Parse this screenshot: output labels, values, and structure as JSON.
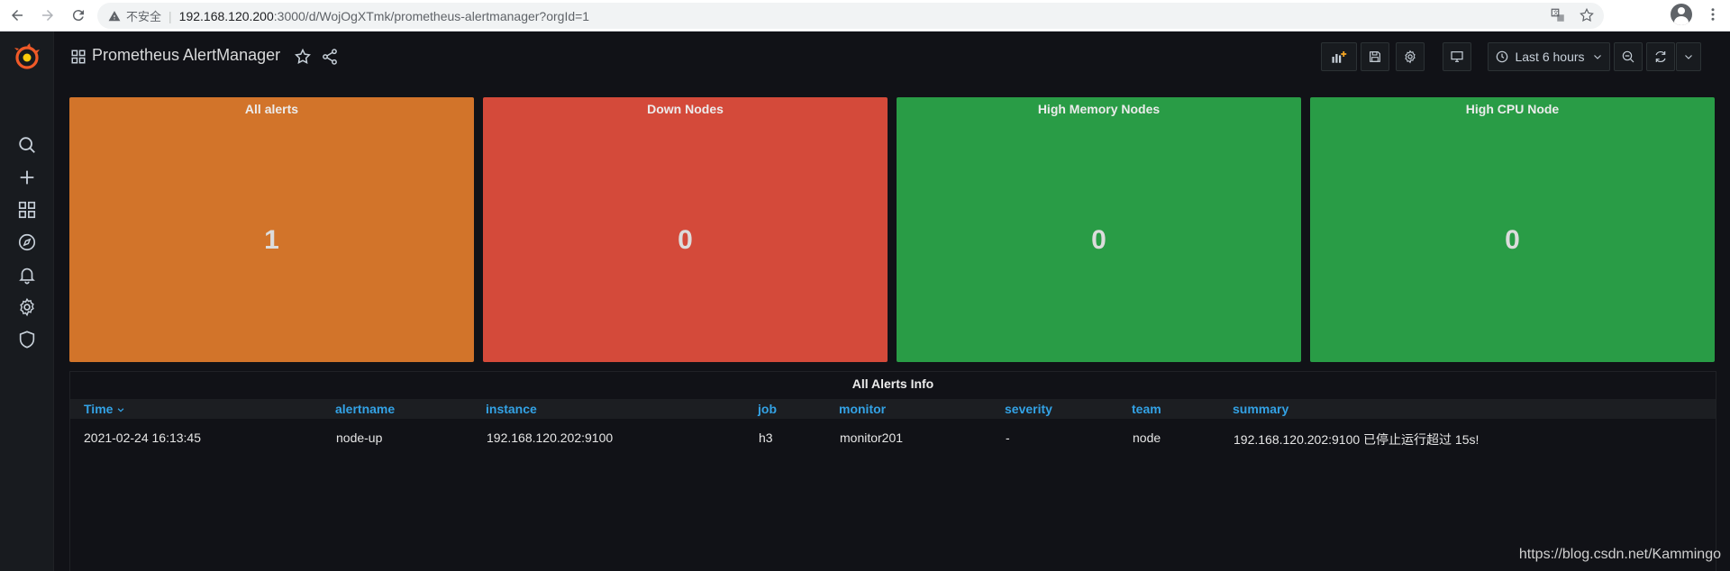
{
  "browser": {
    "insecure_label": "不安全",
    "url_host": "192.168.120.200",
    "url_rest": ":3000/d/WojOgXTmk/prometheus-alertmanager?orgId=1"
  },
  "dashboard": {
    "title": "Prometheus AlertManager",
    "time_range": "Last 6 hours"
  },
  "stat_panels": [
    {
      "title": "All alerts",
      "value": "1",
      "color": "#d2742a"
    },
    {
      "title": "Down Nodes",
      "value": "0",
      "color": "#d44a3a"
    },
    {
      "title": "High Memory Nodes",
      "value": "0",
      "color": "#299c46"
    },
    {
      "title": "High CPU Node",
      "value": "0",
      "color": "#299c46"
    }
  ],
  "alerts_table": {
    "title": "All Alerts Info",
    "columns": [
      "Time",
      "alertname",
      "instance",
      "job",
      "monitor",
      "severity",
      "team",
      "summary"
    ],
    "rows": [
      [
        "2021-02-24 16:13:45",
        "node-up",
        "192.168.120.202:9100",
        "h3",
        "monitor201",
        "-",
        "node",
        "192.168.120.202:9100 已停止运行超过 15s!"
      ]
    ]
  },
  "watermark": "https://blog.csdn.net/Kammingo",
  "colors": {
    "link_blue": "#33a2e5",
    "grafana_orange": "#f05a28"
  }
}
